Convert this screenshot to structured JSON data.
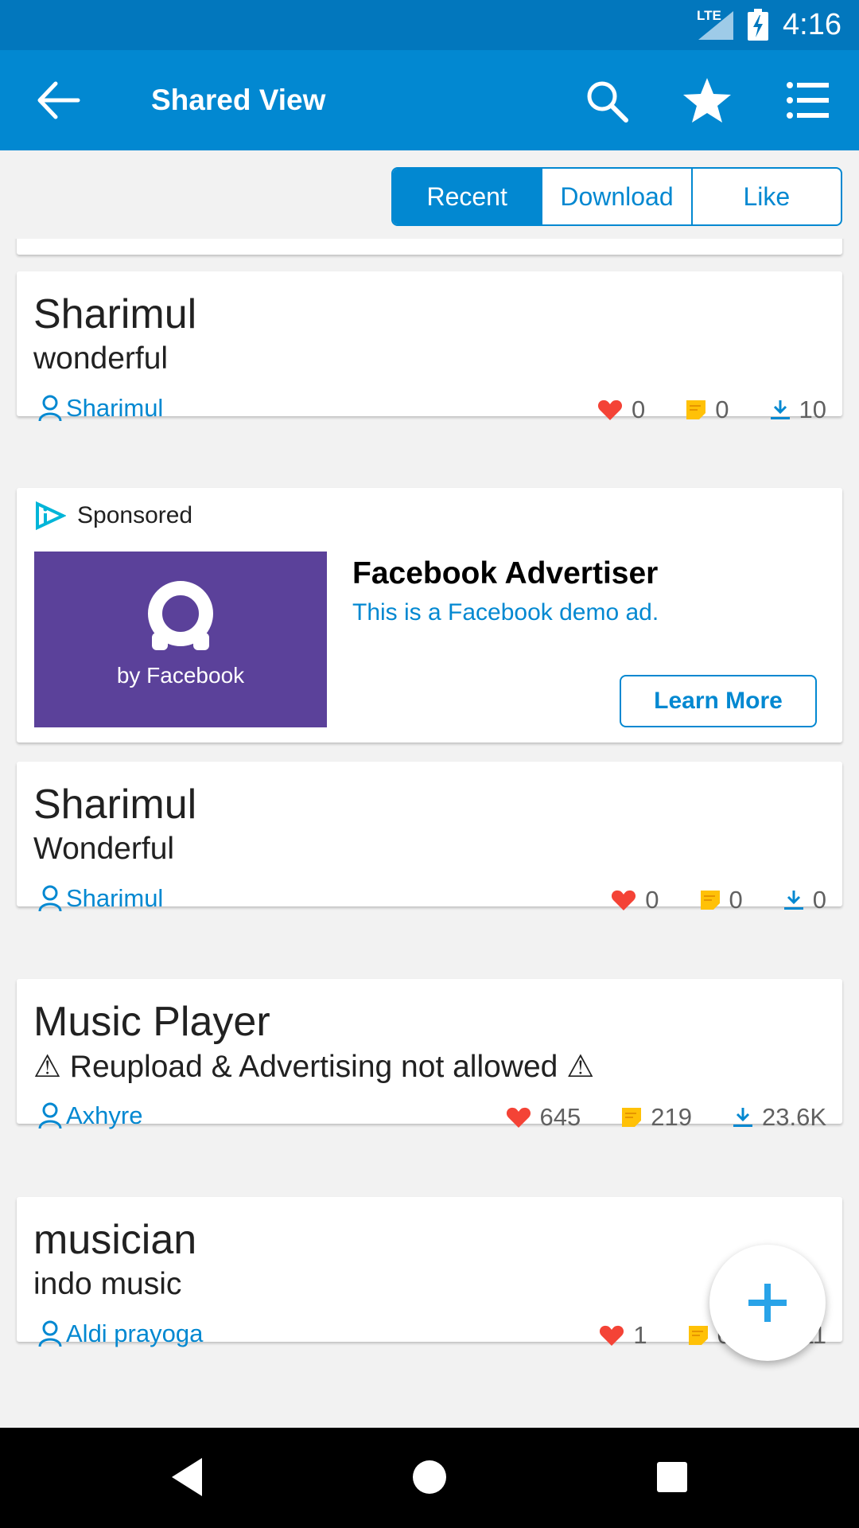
{
  "status": {
    "network": "LTE",
    "time": "4:16"
  },
  "appbar": {
    "title": "Shared View"
  },
  "tabs": [
    {
      "label": "Recent",
      "active": true
    },
    {
      "label": "Download",
      "active": false
    },
    {
      "label": "Like",
      "active": false
    }
  ],
  "posts": [
    {
      "title": "Sharimul",
      "description": "wonderful",
      "author": "Sharimul",
      "likes": "0",
      "comments": "0",
      "downloads": "10"
    },
    {
      "title": "Sharimul",
      "description": "Wonderful",
      "author": "Sharimul",
      "likes": "0",
      "comments": "0",
      "downloads": "0"
    },
    {
      "title": "Music Player",
      "description": "⚠ Reupload & Advertising not allowed ⚠",
      "author": "Axhyre",
      "likes": "645",
      "comments": "219",
      "downloads": "23.6K"
    },
    {
      "title": "musician",
      "description": "indo music",
      "author": "Aldi prayoga",
      "likes": "1",
      "comments": "0",
      "downloads": "11"
    }
  ],
  "ad": {
    "sponsored_label": "Sponsored",
    "image_caption": "by Facebook",
    "advertiser": "Facebook Advertiser",
    "text": "This is a Facebook demo ad.",
    "cta": "Learn More"
  },
  "colors": {
    "primary": "#0288d1",
    "status_bar": "#0277bd",
    "heart": "#f44336",
    "comment": "#ffc107",
    "ad_bg": "#5b419a"
  }
}
